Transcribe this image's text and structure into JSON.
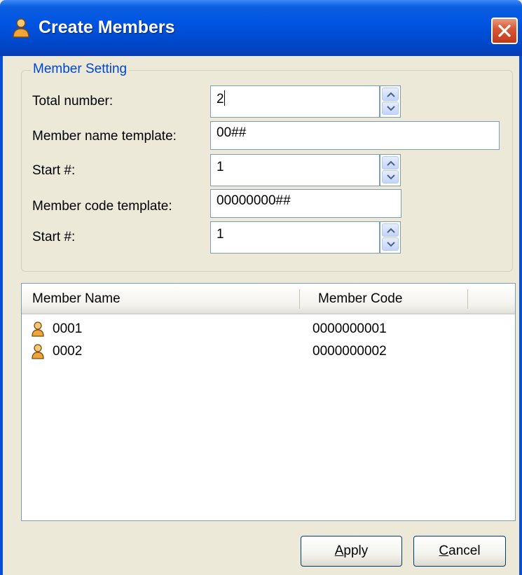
{
  "window": {
    "title": "Create Members",
    "icon": "member-icon",
    "close_icon": "close-icon",
    "accent": "#0054e3"
  },
  "group": {
    "legend": "Member Setting",
    "fields": {
      "total_number": {
        "label": "Total number:",
        "value": "2"
      },
      "name_template": {
        "label": "Member name template:",
        "value": "00##"
      },
      "name_start": {
        "label": "Start #:",
        "value": "1"
      },
      "code_template": {
        "label": "Member code template:",
        "value": "00000000##"
      },
      "code_start": {
        "label": "Start #:",
        "value": "1"
      }
    }
  },
  "list": {
    "columns": [
      "Member Name",
      "Member Code"
    ],
    "rows": [
      {
        "name": "0001",
        "code": "0000000001",
        "icon": "member-icon"
      },
      {
        "name": "0002",
        "code": "0000000002",
        "icon": "member-icon"
      }
    ]
  },
  "buttons": {
    "apply": {
      "mnemonic": "A",
      "rest": "pply"
    },
    "cancel": {
      "mnemonic": "C",
      "rest": "ancel"
    }
  }
}
